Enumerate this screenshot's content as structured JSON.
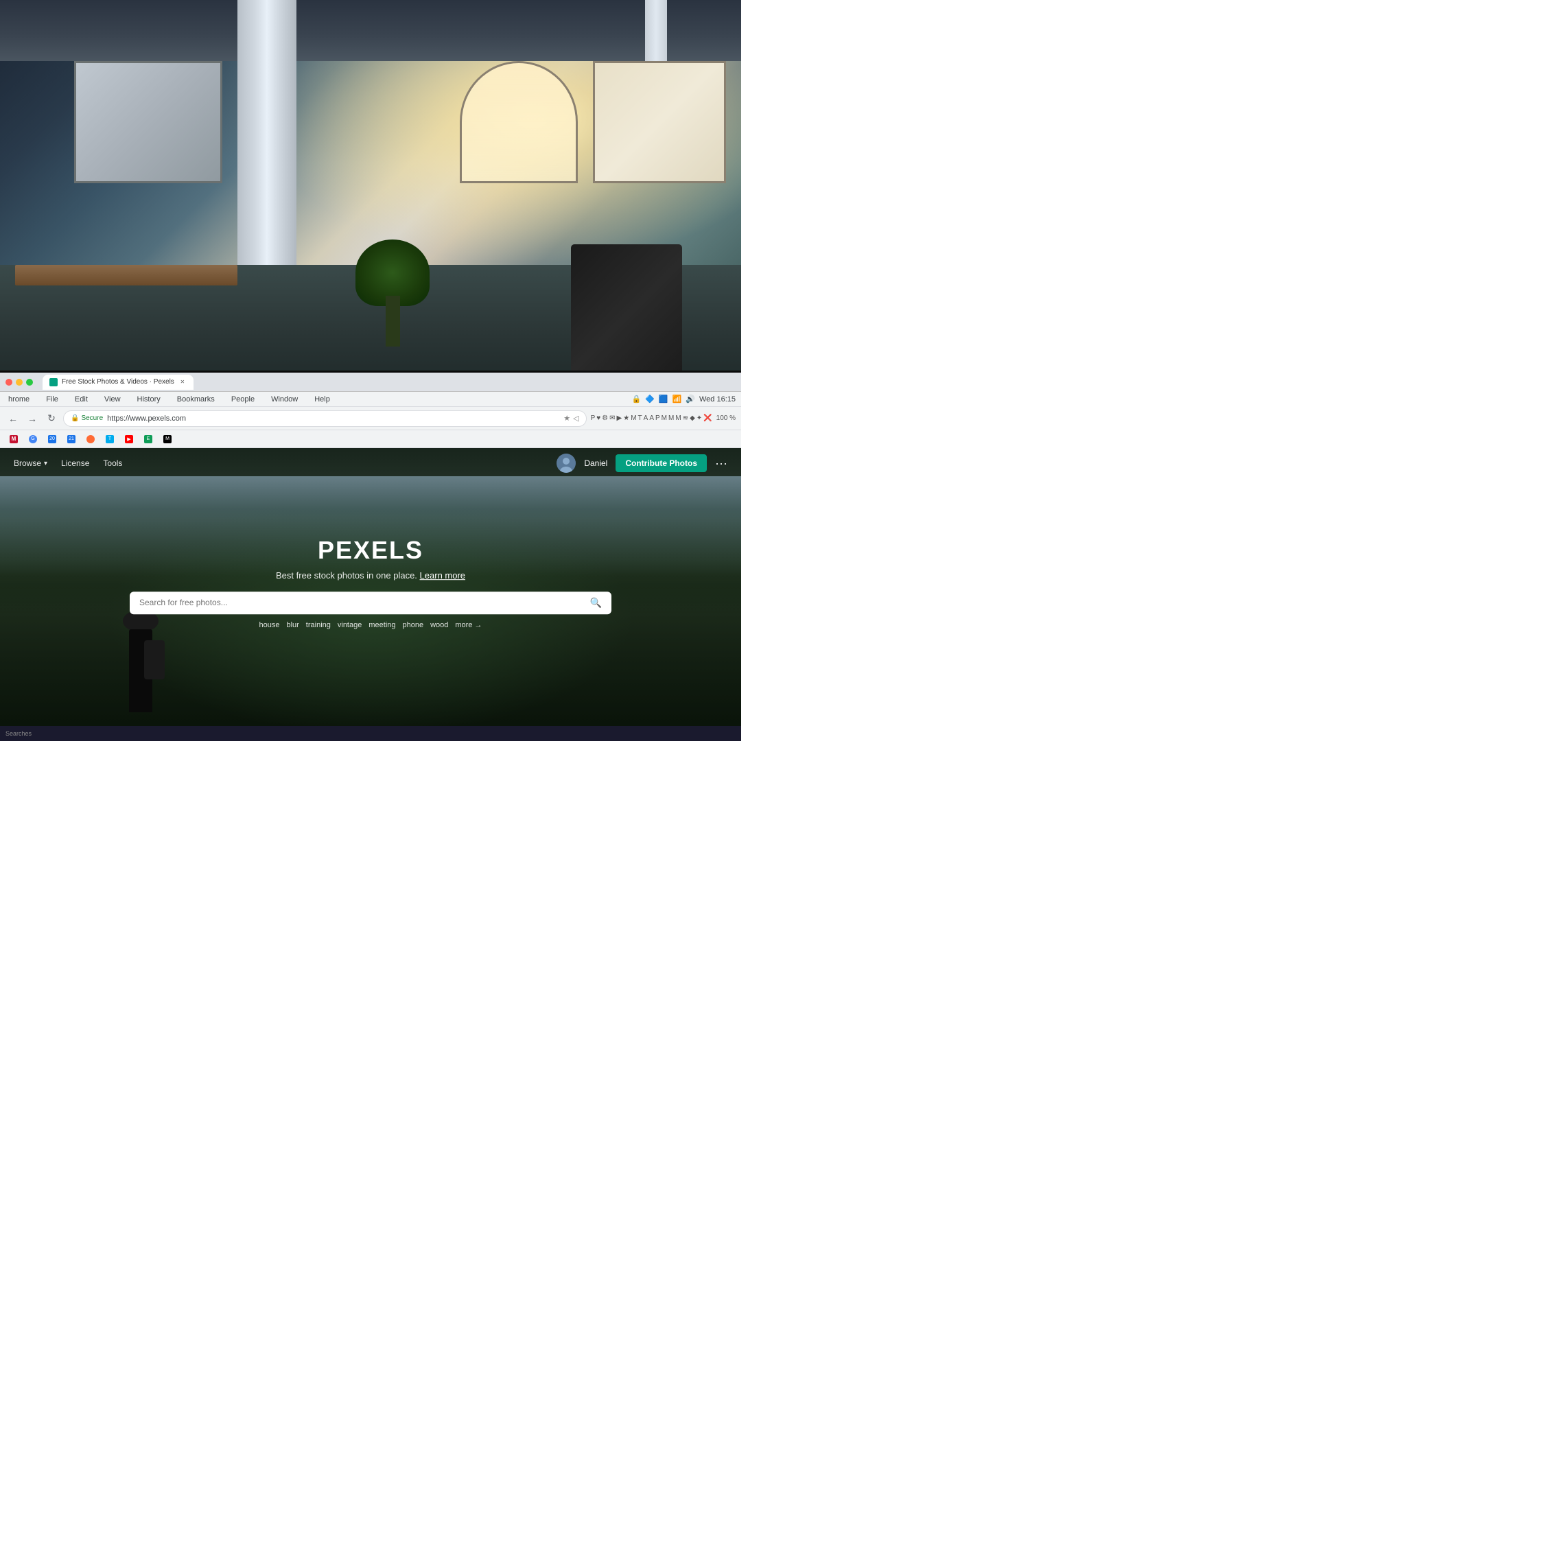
{
  "background": {
    "description": "Office interior with blurred background"
  },
  "browser": {
    "title": "Pexels",
    "tab_label": "Free Stock Photos & Videos · Pexels",
    "window_controls": {
      "close": "×",
      "minimize": "–",
      "maximize": "+"
    },
    "menu_bar": {
      "items": [
        "hrome",
        "File",
        "Edit",
        "View",
        "History",
        "Bookmarks",
        "People",
        "Window",
        "Help"
      ]
    },
    "toolbar": {
      "back": "←",
      "forward": "→",
      "reload": "↻",
      "address": {
        "secure_label": "Secure",
        "url": "https://www.pexels.com"
      },
      "zoom": "100 %",
      "time": "Wed 16:15"
    },
    "bookmarks": [
      {
        "label": "M",
        "color": "#c41230"
      },
      {
        "label": "G",
        "color": "#4285f4"
      },
      {
        "label": "20",
        "color": "#1a73e8"
      },
      {
        "label": "21",
        "color": "#1a73e8"
      },
      {
        "label": "⬤",
        "color": "#ff6b35"
      },
      {
        "label": "T",
        "color": "#00acee"
      },
      {
        "label": "Y",
        "color": "#ff0000"
      },
      {
        "label": "E",
        "color": "#0f9d58"
      },
      {
        "label": "M",
        "color": "#4285f4"
      }
    ]
  },
  "pexels": {
    "nav": {
      "browse": "Browse",
      "license": "License",
      "tools": "Tools",
      "user_name": "Daniel",
      "contribute_label": "Contribute Photos",
      "more": "···"
    },
    "hero": {
      "logo": "PEXELS",
      "tagline": "Best free stock photos in one place.",
      "tagline_link": "Learn more",
      "search_placeholder": "Search for free photos...",
      "suggestions": [
        "house",
        "blur",
        "training",
        "vintage",
        "meeting",
        "phone",
        "wood"
      ],
      "more_label": "more →"
    }
  },
  "taskbar": {
    "label": "Searches"
  }
}
